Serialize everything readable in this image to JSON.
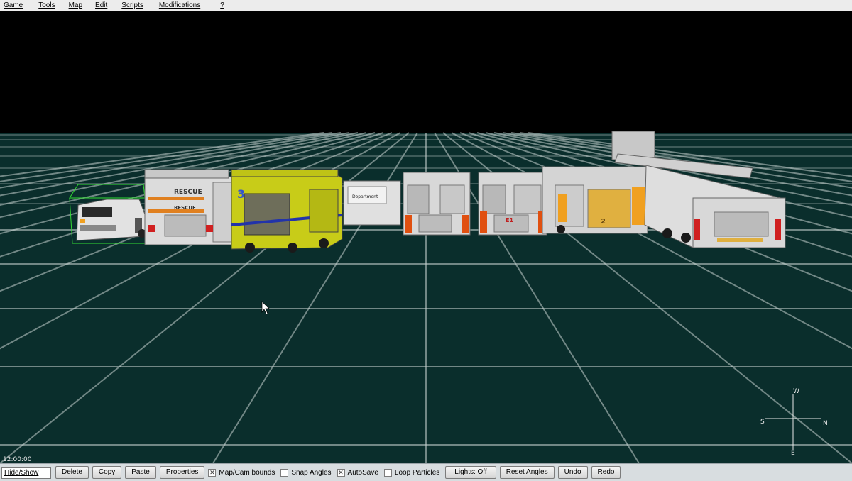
{
  "menu": {
    "items": [
      "Game",
      "Tools",
      "Map",
      "Edit",
      "Scripts",
      "Modifications",
      "?"
    ]
  },
  "viewport": {
    "background_sky": "#000000",
    "background_ground": "#0a2e2c",
    "grid_color": "#c9d4d2",
    "selection_color": "#33dd33",
    "vehicle_labels": {
      "rescue_top": "RESCUE",
      "rescue_bottom": "RESCUE",
      "arff_number": "3",
      "department": "Department",
      "engine1": "E1",
      "engine2": "2"
    },
    "compass": {
      "north": "N",
      "south": "S",
      "east": "E",
      "west": "W"
    },
    "clock": "12:00:00"
  },
  "toolbar": {
    "hide_show": "Hide/Show",
    "delete": "Delete",
    "copy": "Copy",
    "paste": "Paste",
    "properties": "Properties",
    "map_cam_bounds": {
      "label": "Map/Cam bounds",
      "checked": true
    },
    "snap_angles": {
      "label": "Snap Angles",
      "checked": false
    },
    "autosave": {
      "label": "AutoSave",
      "checked": true
    },
    "loop_particles": {
      "label": "Loop Particles",
      "checked": false
    },
    "lights": "Lights: Off",
    "reset_angles": "Reset Angles",
    "undo": "Undo",
    "redo": "Redo"
  }
}
